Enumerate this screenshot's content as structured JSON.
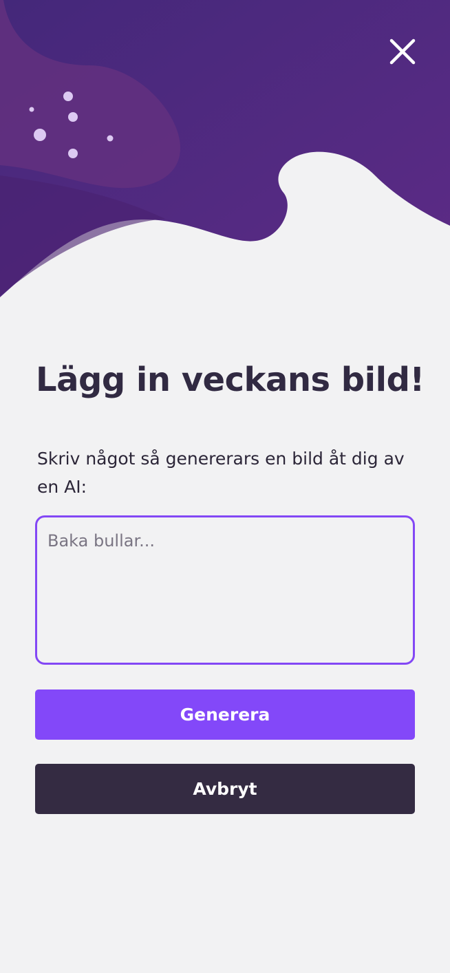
{
  "dialog": {
    "title": "Lägg in veckans bild!",
    "description": "Skriv något så genererars en bild åt dig av en AI:",
    "prompt": {
      "value": "",
      "placeholder": "Baka bullar..."
    },
    "generate_label": "Generera",
    "cancel_label": "Avbryt",
    "close_icon": "close-icon"
  },
  "colors": {
    "background": "#f2f2f3",
    "hero_purple_dark": "#4b2a78",
    "hero_purple": "#5a2d85",
    "accent": "#8348f9",
    "dark_button": "#342b42",
    "title_text": "#312a42"
  }
}
